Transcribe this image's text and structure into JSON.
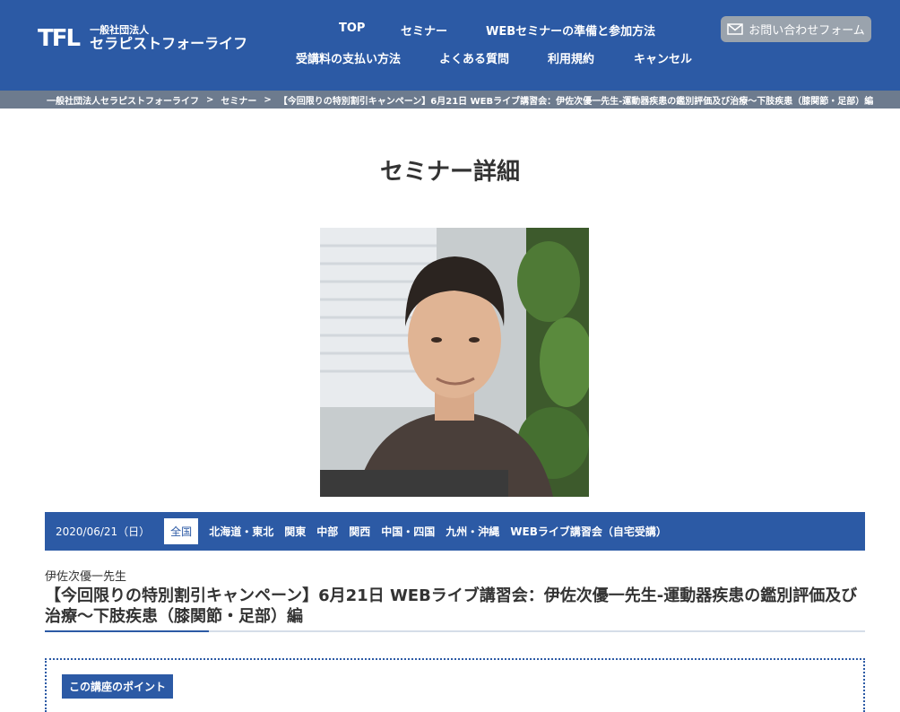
{
  "header": {
    "logo_mark": "TFL",
    "logo_small": "一般社団法人",
    "logo_large": "セラピストフォーライフ",
    "nav_row1": [
      "TOP",
      "セミナー",
      "WEBセミナーの準備と参加方法"
    ],
    "nav_row2": [
      "受講料の支払い方法",
      "よくある質問",
      "利用規約",
      "キャンセル"
    ],
    "contact_label": "お問い合わせフォーム"
  },
  "breadcrumb": {
    "items": [
      "一般社団法人セラピストフォーライフ",
      "セミナー",
      "【今回限りの特別割引キャンペーン】6月21日 WEBライブ講習会：伊佐次優一先生-運動器疾患の鑑別評価及び治療〜下肢疾患（膝関節・足部）編"
    ],
    "separators": [
      ">",
      ">"
    ]
  },
  "page_title": "セミナー詳細",
  "categories": {
    "date": "2020/06/21（日）",
    "tags": [
      "全国",
      "北海道・東北",
      "関東",
      "中部",
      "関西",
      "中国・四国",
      "九州・沖縄",
      "WEBライブ講習会（自宅受講）"
    ],
    "active": "全国"
  },
  "seminar": {
    "teacher": "伊佐次優一先生",
    "title": "【今回限りの特別割引キャンペーン】6月21日 WEBライブ講習会：伊佐次優一先生-運動器疾患の鑑別評価及び治療〜下肢疾患（膝関節・足部）編",
    "points_label": "この講座のポイント"
  },
  "colors": {
    "primary": "#2c5aa5",
    "breadcrumb_bg": "#6d7b8e",
    "contact_bg": "#9aa3ad"
  }
}
